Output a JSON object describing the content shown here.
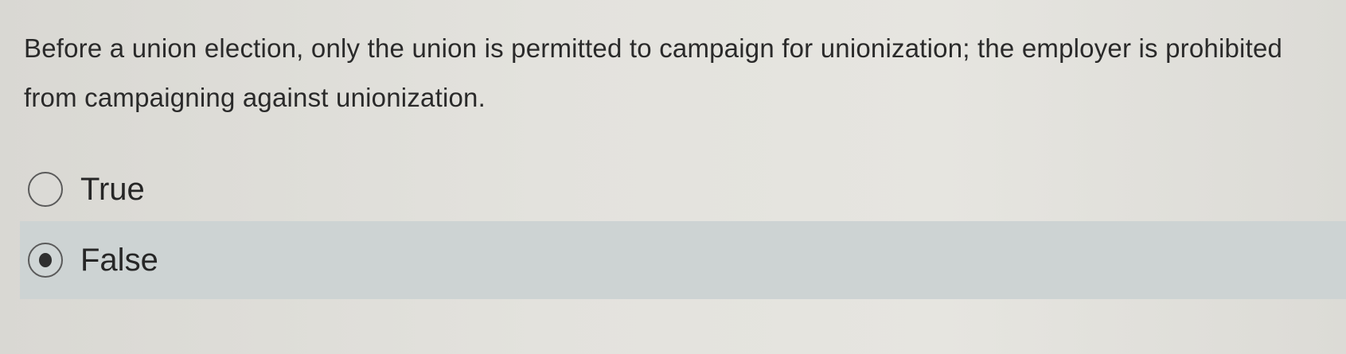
{
  "question": {
    "text": "Before a union election, only the union is permitted to campaign for unionization; the employer is prohibited from campaigning against unionization."
  },
  "options": [
    {
      "label": "True",
      "selected": false
    },
    {
      "label": "False",
      "selected": true
    }
  ],
  "colors": {
    "selected_row_background": "#cdd3d3",
    "page_background": "#e3e2dd"
  }
}
